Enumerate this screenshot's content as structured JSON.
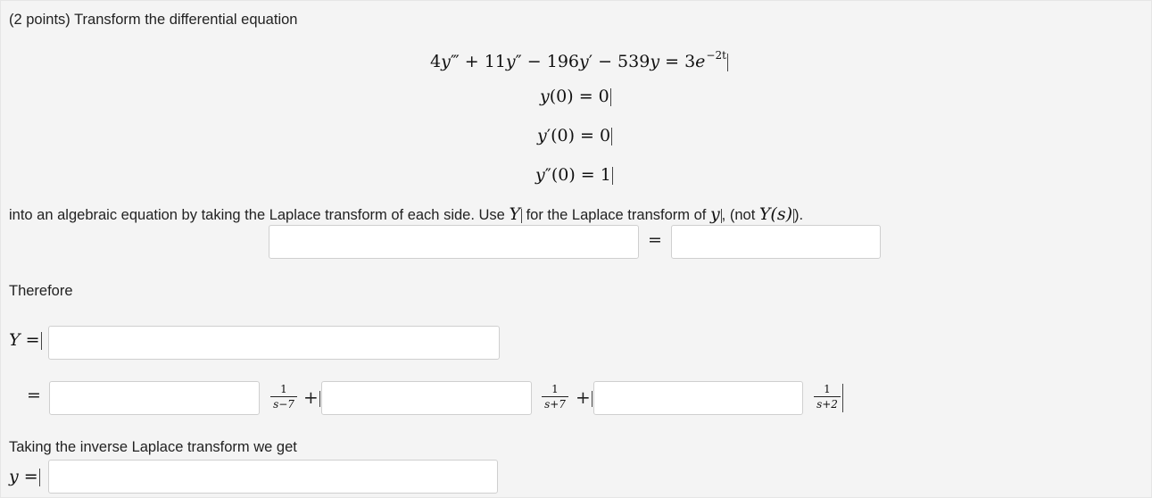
{
  "problem": {
    "header": "(2 points) Transform the differential equation",
    "equation": {
      "lhs_a": "4",
      "lhs_b": "+ 11",
      "lhs_c": "− 196",
      "lhs_d": "− 539",
      "rhs": "= 3",
      "exponent": "−2t"
    },
    "initial": [
      {
        "label": "(0) = ",
        "value": "0"
      },
      {
        "label": "(0) = ",
        "value": "0"
      },
      {
        "label": "(0) = ",
        "value": "1"
      }
    ],
    "instruction_a": "into an algebraic equation by taking the Laplace transform of each side. Use ",
    "instruction_b": " for the Laplace transform of ",
    "instruction_c": ", (not ",
    "instruction_d": ").",
    "Y_symbol": "Y",
    "y_symbol": "y",
    "Ys_text": "Y(s)"
  },
  "transform_row": {
    "lhs_value": "",
    "rhs_value": "",
    "equals": "="
  },
  "therefore_label": "Therefore",
  "Y_row": {
    "label": "Y =",
    "value": ""
  },
  "partial_fractions": {
    "equals": "=",
    "terms": [
      {
        "value": "",
        "numerator": "1",
        "denominator": "s−7"
      },
      {
        "value": "",
        "numerator": "1",
        "denominator": "s+7"
      },
      {
        "value": "",
        "numerator": "1",
        "denominator": "s+2"
      }
    ],
    "plus": "+"
  },
  "inverse": {
    "label": "Taking the inverse Laplace transform we get",
    "y_label": "y =",
    "value": ""
  }
}
